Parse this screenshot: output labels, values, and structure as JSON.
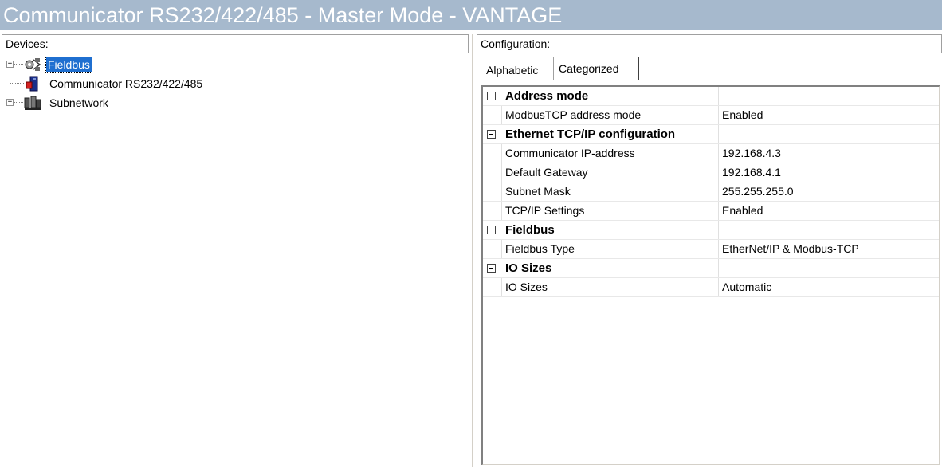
{
  "window": {
    "title": "Communicator RS232/422/485 - Master Mode - VANTAGE"
  },
  "devices_panel": {
    "header": "Devices:",
    "tree": [
      {
        "label": "Fieldbus",
        "icon": "fieldbus-network-icon",
        "expandable": true,
        "selected": true
      },
      {
        "label": "Communicator RS232/422/485",
        "icon": "communicator-module-icon",
        "expandable": false,
        "selected": false
      },
      {
        "label": "Subnetwork",
        "icon": "subnetwork-icon",
        "expandable": true,
        "selected": false
      }
    ]
  },
  "configuration_panel": {
    "header": "Configuration:",
    "tabs": [
      {
        "label": "Alphabetic",
        "active": false
      },
      {
        "label": "Categorized",
        "active": true
      }
    ],
    "categories": [
      {
        "name": "Address mode",
        "properties": [
          {
            "name": "ModbusTCP address mode",
            "value": "Enabled"
          }
        ]
      },
      {
        "name": "Ethernet TCP/IP configuration",
        "properties": [
          {
            "name": "Communicator IP-address",
            "value": "192.168.4.3"
          },
          {
            "name": "Default Gateway",
            "value": "192.168.4.1"
          },
          {
            "name": "Subnet Mask",
            "value": "255.255.255.0"
          },
          {
            "name": "TCP/IP Settings",
            "value": "Enabled"
          }
        ]
      },
      {
        "name": "Fieldbus",
        "properties": [
          {
            "name": "Fieldbus Type",
            "value": "EtherNet/IP & Modbus-TCP"
          }
        ]
      },
      {
        "name": "IO Sizes",
        "properties": [
          {
            "name": "IO Sizes",
            "value": "Automatic"
          }
        ]
      }
    ]
  },
  "colors": {
    "titlebar": "#a6b9cd",
    "selection": "#1f6fd0"
  }
}
